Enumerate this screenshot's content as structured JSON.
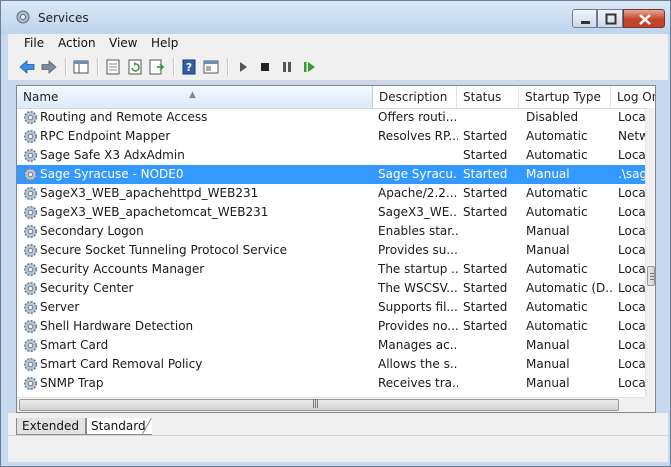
{
  "window": {
    "title": "Services"
  },
  "menu": [
    "File",
    "Action",
    "View",
    "Help"
  ],
  "toolbar": {
    "buttons": [
      "back-icon",
      "forward-icon",
      "console-tree-icon",
      "properties-icon",
      "refresh-icon",
      "export-list-icon",
      "help-icon",
      "details-icon",
      "start-service-icon",
      "stop-service-icon",
      "pause-service-icon",
      "resume-service-icon"
    ]
  },
  "table": {
    "columns": [
      "Name",
      "Description",
      "Status",
      "Startup Type",
      "Log On As"
    ],
    "rows": [
      {
        "name": "Routing and Remote Access",
        "desc": "Offers routi...",
        "status": "",
        "startup": "Disabled",
        "logon": "Local S"
      },
      {
        "name": "RPC Endpoint Mapper",
        "desc": "Resolves RP...",
        "status": "Started",
        "startup": "Automatic",
        "logon": "Netwo"
      },
      {
        "name": "Sage Safe X3 AdxAdmin",
        "desc": "",
        "status": "Started",
        "startup": "Automatic",
        "logon": "Local S"
      },
      {
        "name": "Sage Syracuse - NODE0",
        "desc": "Sage Syracu...",
        "status": "Started",
        "startup": "Manual",
        "logon": ".\\sage"
      },
      {
        "name": "SageX3_WEB_apachehttpd_WEB231",
        "desc": "Apache/2.2....",
        "status": "Started",
        "startup": "Automatic",
        "logon": "Local S"
      },
      {
        "name": "SageX3_WEB_apachetomcat_WEB231",
        "desc": "SageX3_WE...",
        "status": "Started",
        "startup": "Automatic",
        "logon": "Local S"
      },
      {
        "name": "Secondary Logon",
        "desc": "Enables star...",
        "status": "",
        "startup": "Manual",
        "logon": "Local S"
      },
      {
        "name": "Secure Socket Tunneling Protocol Service",
        "desc": "Provides su...",
        "status": "",
        "startup": "Manual",
        "logon": "Local S"
      },
      {
        "name": "Security Accounts Manager",
        "desc": "The startup ...",
        "status": "Started",
        "startup": "Automatic",
        "logon": "Local S"
      },
      {
        "name": "Security Center",
        "desc": "The WSCSV...",
        "status": "Started",
        "startup": "Automatic (D...",
        "logon": "Local S"
      },
      {
        "name": "Server",
        "desc": "Supports fil...",
        "status": "Started",
        "startup": "Automatic",
        "logon": "Local S"
      },
      {
        "name": "Shell Hardware Detection",
        "desc": "Provides no...",
        "status": "Started",
        "startup": "Automatic",
        "logon": "Local S"
      },
      {
        "name": "Smart Card",
        "desc": "Manages ac...",
        "status": "",
        "startup": "Manual",
        "logon": "Local S"
      },
      {
        "name": "Smart Card Removal Policy",
        "desc": "Allows the s...",
        "status": "",
        "startup": "Manual",
        "logon": "Local S"
      },
      {
        "name": "SNMP Trap",
        "desc": "Receives tra...",
        "status": "",
        "startup": "Manual",
        "logon": "Local S"
      }
    ],
    "selected_row": "Sage Syracuse - NODE0"
  },
  "tabs": [
    "Extended",
    "Standard"
  ],
  "active_tab": "Standard",
  "colors": {
    "selection": "#3399ff",
    "chrome": "#c6d9ee"
  }
}
